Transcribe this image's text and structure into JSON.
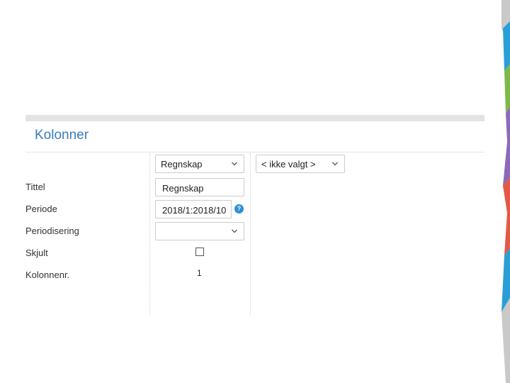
{
  "section": {
    "title": "Kolonner"
  },
  "columns": {
    "column1_select": "Regnskap",
    "column2_select": "< ikke valgt >"
  },
  "rows": {
    "tittel": {
      "label": "Tittel",
      "value": "Regnskap"
    },
    "periode": {
      "label": "Periode",
      "value": "2018/1:2018/10"
    },
    "periodisering": {
      "label": "Periodisering",
      "value": ""
    },
    "skjult": {
      "label": "Skjult",
      "checked": false
    },
    "kolonnenr": {
      "label": "Kolonnenr.",
      "value": "1"
    }
  },
  "help": {
    "glyph": "?"
  },
  "colors": {
    "accent": "#3a7bbf",
    "help_icon": "#2a8fd6",
    "deco": [
      "#e05a46",
      "#f39c3c",
      "#7fb84a",
      "#2a9fd6",
      "#8d6ab8",
      "#c9c9c9"
    ]
  }
}
